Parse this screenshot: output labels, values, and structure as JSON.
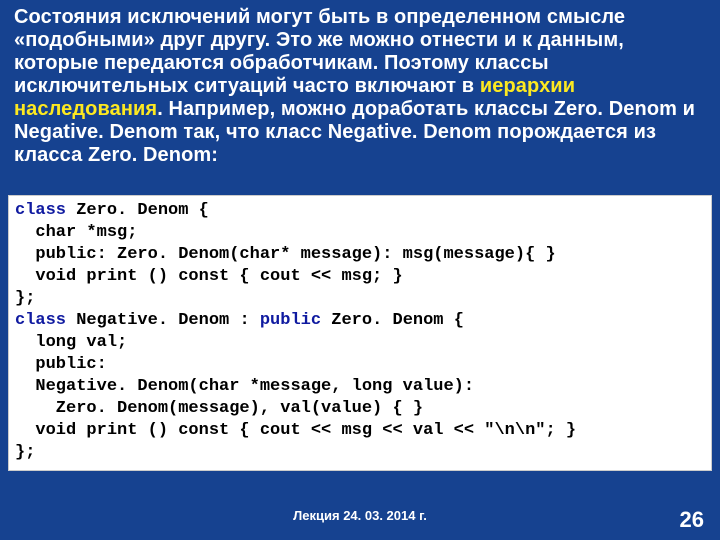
{
  "para": {
    "t1": "Состояния исключений могут быть в определенном смысле «подобными» друг другу. Это же можно отнести и к данным, которые передаются обработчикам. Поэтому классы исключительных ситуаций часто включают в ",
    "hl": "иерархии наследования",
    "t2": ". Например, можно доработать классы Zero. Denom и Negative. Denom так, что класс Negative. Denom порождается из класса Zero. Denom:"
  },
  "code": {
    "l1a": "class",
    "l1b": " Zero. Denom {",
    "l2": "  char *msg;",
    "l3": "  public: Zero. Denom(char* message): msg(message){ }",
    "l4": "  void print () const { cout << msg; }",
    "l5": "};",
    "l6a": "class",
    "l6b": " Negative. Denom : ",
    "l6c": "public",
    "l6d": " Zero. Denom {",
    "l7": "  long val;",
    "l8": "  public:",
    "l9": "  Negative. Denom(char *message, long value):",
    "l10": "    Zero. Denom(message), val(value) { }",
    "l11": "  void print () const { cout << msg << val << \"\\n\\n\"; }",
    "l12": "};"
  },
  "footer": {
    "center": "Лекция 24. 03. 2014 г.",
    "page": "26"
  }
}
